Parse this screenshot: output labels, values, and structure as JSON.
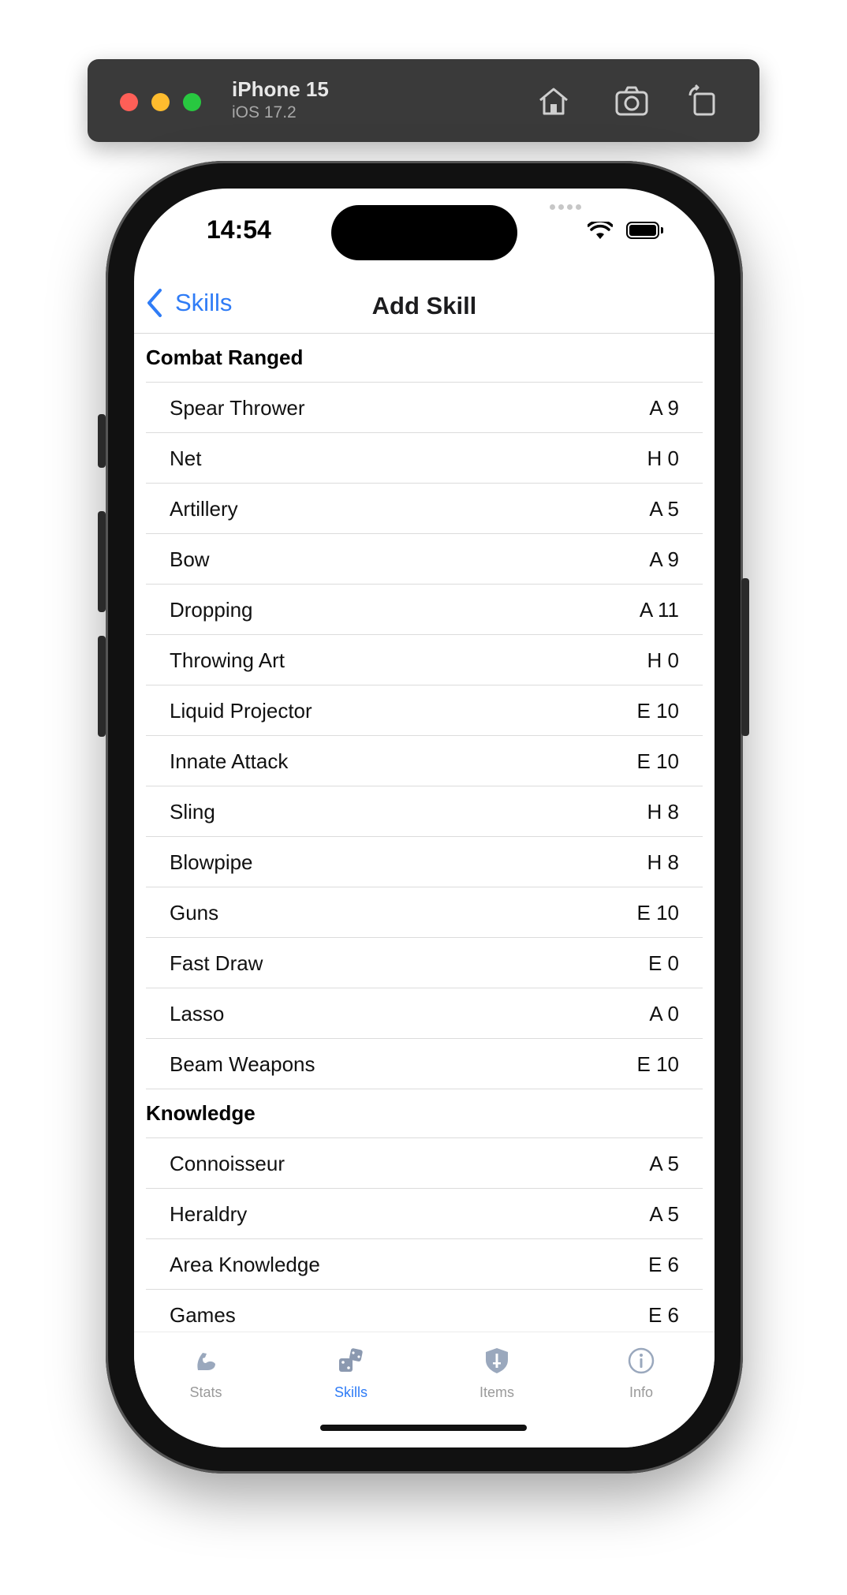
{
  "simulator": {
    "device_name": "iPhone 15",
    "os_version": "iOS 17.2",
    "icons": [
      "home-icon",
      "screenshot-icon",
      "rotate-icon"
    ]
  },
  "status_bar": {
    "time": "14:54"
  },
  "nav": {
    "back_label": "Skills",
    "title": "Add Skill"
  },
  "sections": [
    {
      "header": "Combat Ranged",
      "rows": [
        {
          "name": "Spear Thrower",
          "cost": "A 9"
        },
        {
          "name": "Net",
          "cost": "H 0"
        },
        {
          "name": "Artillery",
          "cost": "A 5"
        },
        {
          "name": "Bow",
          "cost": "A 9"
        },
        {
          "name": "Dropping",
          "cost": "A 11"
        },
        {
          "name": "Throwing Art",
          "cost": "H 0"
        },
        {
          "name": "Liquid Projector",
          "cost": "E 10"
        },
        {
          "name": "Innate Attack",
          "cost": "E 10"
        },
        {
          "name": "Sling",
          "cost": "H 8"
        },
        {
          "name": "Blowpipe",
          "cost": "H 8"
        },
        {
          "name": "Guns",
          "cost": "E 10"
        },
        {
          "name": "Fast Draw",
          "cost": "E 0"
        },
        {
          "name": "Lasso",
          "cost": "A 0"
        },
        {
          "name": "Beam Weapons",
          "cost": "E 10"
        }
      ]
    },
    {
      "header": "Knowledge",
      "rows": [
        {
          "name": "Connoisseur",
          "cost": "A 5"
        },
        {
          "name": "Heraldry",
          "cost": "A 5"
        },
        {
          "name": "Area Knowledge",
          "cost": "E 6"
        },
        {
          "name": "Games",
          "cost": "E 6"
        }
      ]
    }
  ],
  "tabs": [
    {
      "label": "Stats",
      "icon": "muscle-icon",
      "active": false
    },
    {
      "label": "Skills",
      "icon": "dice-icon",
      "active": true
    },
    {
      "label": "Items",
      "icon": "shield-icon",
      "active": false
    },
    {
      "label": "Info",
      "icon": "info-icon",
      "active": false
    }
  ],
  "colors": {
    "accent": "#2f7cf6",
    "inactive_tab": "#9a9a9a"
  }
}
